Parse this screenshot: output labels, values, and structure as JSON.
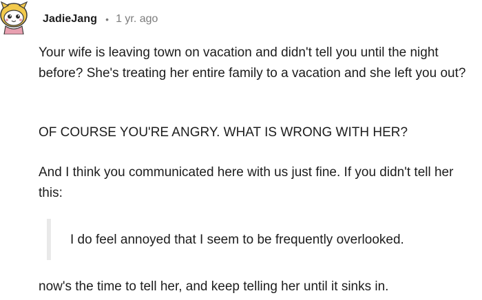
{
  "comment": {
    "author": "JadieJang",
    "separator": "•",
    "timestamp": "1 yr. ago",
    "avatar_icon": "snoo-avatar-icon",
    "paragraphs": [
      "Your wife is leaving town on vacation and didn't tell you until the night before? She's treating her entire family to a vacation and she left you out?",
      "OF COURSE YOU'RE ANGRY. WHAT IS WRONG WITH HER?",
      "And I think you communicated here with us just fine. If you didn't tell her this:"
    ],
    "quote": "I do feel annoyed that I seem to be frequently overlooked.",
    "closing": "now's the time to tell her, and keep telling her until it sinks in."
  },
  "colors": {
    "text": "#1c1c1c",
    "meta": "#7c7c7c",
    "quote_bar": "#e9e9e9",
    "avatar_yellow": "#f2c94c",
    "avatar_pink": "#e8a0b0"
  }
}
